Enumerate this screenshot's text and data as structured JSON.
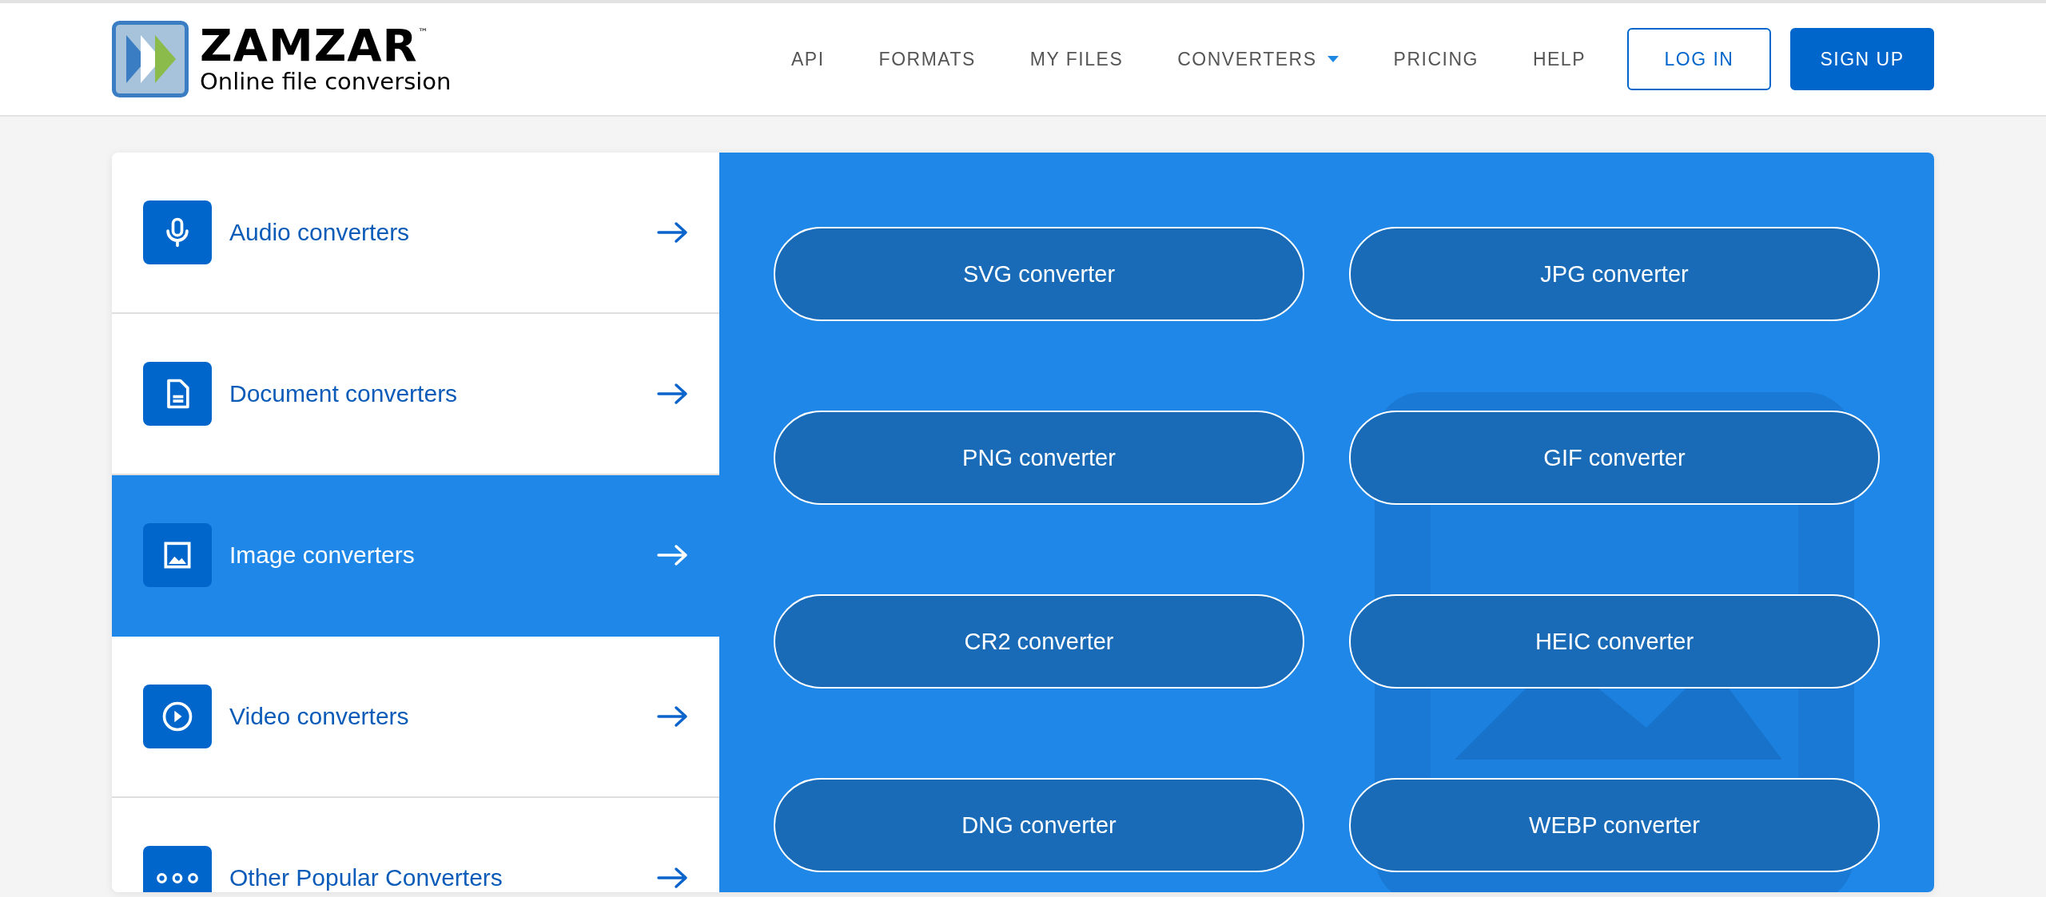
{
  "header": {
    "logo": {
      "name": "ZAMZAR",
      "trademark": "™",
      "tagline": "Online file conversion"
    },
    "nav": [
      {
        "label": "API",
        "kind": "link"
      },
      {
        "label": "FORMATS",
        "kind": "link"
      },
      {
        "label": "MY FILES",
        "kind": "link"
      },
      {
        "label": "CONVERTERS",
        "kind": "dropdown"
      },
      {
        "label": "PRICING",
        "kind": "link"
      },
      {
        "label": "HELP",
        "kind": "link"
      }
    ],
    "buttons": [
      {
        "label": "LOG IN",
        "kind": "outline"
      },
      {
        "label": "SIGN UP",
        "kind": "filled"
      }
    ]
  },
  "categories": [
    {
      "label": "Audio converters",
      "kind": "audio",
      "selected": false
    },
    {
      "label": "Document converters",
      "kind": "document",
      "selected": false
    },
    {
      "label": "Image converters",
      "kind": "image",
      "selected": true
    },
    {
      "label": "Video converters",
      "kind": "video",
      "selected": false
    },
    {
      "label": "Other Popular Converters",
      "kind": "other",
      "selected": false
    }
  ],
  "converters": [
    "SVG converter",
    "JPG converter",
    "PNG converter",
    "GIF converter",
    "CR2 converter",
    "HEIC converter",
    "DNG converter",
    "WEBP converter"
  ]
}
